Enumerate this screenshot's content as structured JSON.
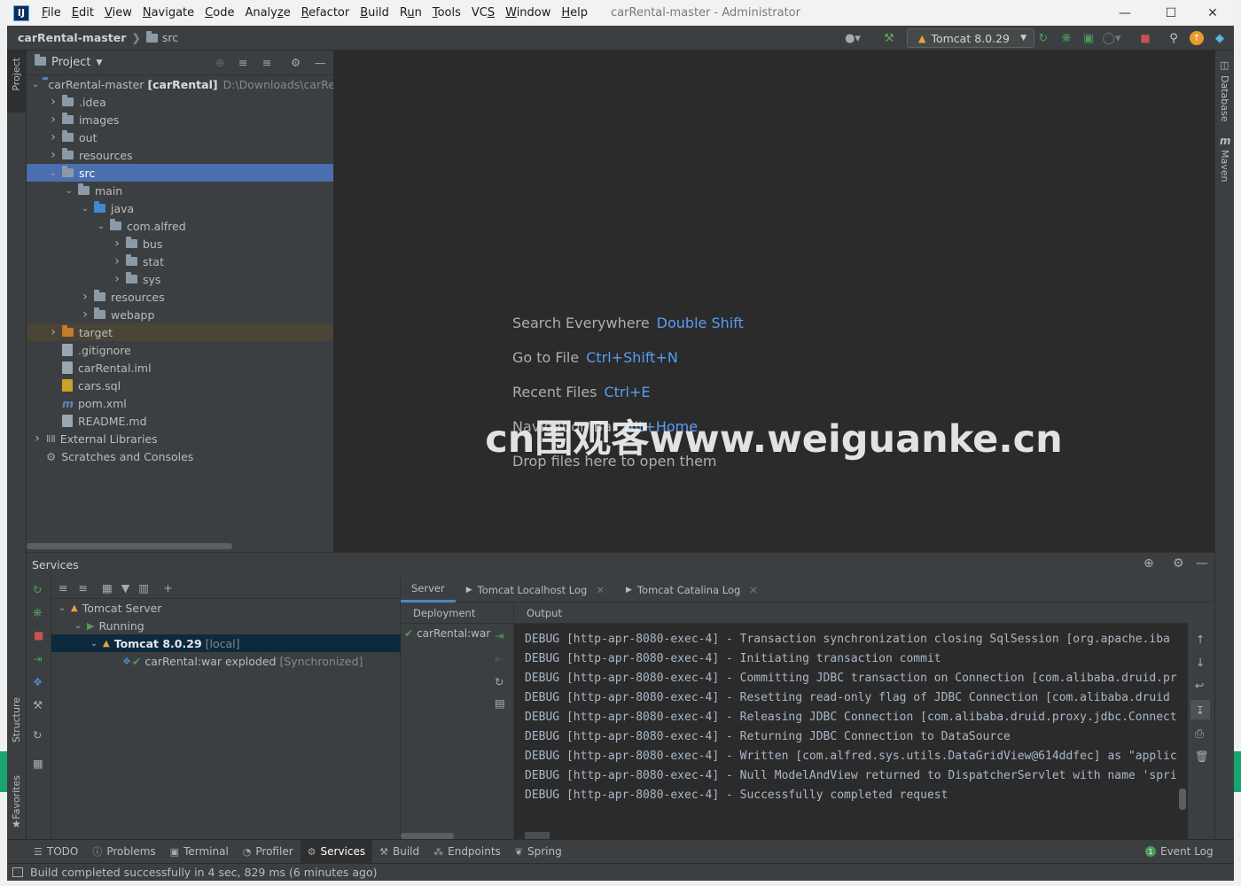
{
  "menubar": {
    "items": [
      {
        "pre": "",
        "u": "F",
        "post": "ile"
      },
      {
        "pre": "",
        "u": "E",
        "post": "dit"
      },
      {
        "pre": "",
        "u": "V",
        "post": "iew"
      },
      {
        "pre": "",
        "u": "N",
        "post": "avigate"
      },
      {
        "pre": "",
        "u": "C",
        "post": "ode"
      },
      {
        "pre": "Analy",
        "u": "z",
        "post": "e"
      },
      {
        "pre": "",
        "u": "R",
        "post": "efactor"
      },
      {
        "pre": "",
        "u": "B",
        "post": "uild"
      },
      {
        "pre": "R",
        "u": "u",
        "post": "n"
      },
      {
        "pre": "",
        "u": "T",
        "post": "ools"
      },
      {
        "pre": "VC",
        "u": "S",
        "post": ""
      },
      {
        "pre": "",
        "u": "W",
        "post": "indow"
      },
      {
        "pre": "",
        "u": "H",
        "post": "elp"
      }
    ],
    "window_title": "carRental-master - Administrator",
    "app_icon": "IJ"
  },
  "navbar": {
    "root": "carRental-master",
    "child": "src",
    "run_config": "Tomcat 8.0.29"
  },
  "side_tabs": {
    "project": "Project",
    "structure": "Structure",
    "favorites": "Favorites",
    "database": "Database",
    "maven": "Maven"
  },
  "project": {
    "title": "Project",
    "root_name": "carRental-master",
    "root_module": "[carRental]",
    "root_path": "D:\\Downloads\\carRen",
    "tree": [
      {
        "label": ".idea",
        "indent": 1
      },
      {
        "label": "images",
        "indent": 1
      },
      {
        "label": "out",
        "indent": 1
      },
      {
        "label": "resources",
        "indent": 1
      },
      {
        "label": "src",
        "indent": 1
      },
      {
        "label": "main",
        "indent": 2
      },
      {
        "label": "java",
        "indent": 3
      },
      {
        "label": "com.alfred",
        "indent": 4
      },
      {
        "label": "bus",
        "indent": 5
      },
      {
        "label": "stat",
        "indent": 5
      },
      {
        "label": "sys",
        "indent": 5
      },
      {
        "label": "resources",
        "indent": 3
      },
      {
        "label": "webapp",
        "indent": 3
      },
      {
        "label": "target",
        "indent": 1
      },
      {
        "label": ".gitignore",
        "indent": 1
      },
      {
        "label": "carRental.iml",
        "indent": 1
      },
      {
        "label": "cars.sql",
        "indent": 1
      },
      {
        "label": "pom.xml",
        "indent": 1
      },
      {
        "label": "README.md",
        "indent": 1
      },
      {
        "label": "External Libraries",
        "indent": 0
      },
      {
        "label": "Scratches and Consoles",
        "indent": 0
      }
    ]
  },
  "editor": {
    "hints": [
      {
        "text": "Search Everywhere",
        "key": "Double Shift"
      },
      {
        "text": "Go to File",
        "key": "Ctrl+Shift+N"
      },
      {
        "text": "Recent Files",
        "key": "Ctrl+E"
      },
      {
        "text": "Navigation Bar",
        "key": "Alt+Home"
      },
      {
        "text": "Drop files here to open them",
        "key": ""
      }
    ],
    "watermark": "cn围观客www.weiguanke.cn"
  },
  "services": {
    "title": "Services",
    "tree": {
      "server": "Tomcat Server",
      "status": "Running",
      "instance": "Tomcat 8.0.29",
      "instance_tag": "[local]",
      "artifact": "carRental:war exploded",
      "artifact_tag": "[Synchronized]"
    },
    "tabs": [
      "Server",
      "Tomcat Localhost Log",
      "Tomcat Catalina Log"
    ],
    "deployment_header": "Deployment",
    "deployment_item": "carRental:war",
    "output_header": "Output",
    "log": [
      "DEBUG [http-apr-8080-exec-4] - Transaction synchronization closing SqlSession [org.apache.iba",
      "DEBUG [http-apr-8080-exec-4] - Initiating transaction commit",
      "DEBUG [http-apr-8080-exec-4] - Committing JDBC transaction on Connection [com.alibaba.druid.pr",
      "DEBUG [http-apr-8080-exec-4] - Resetting read-only flag of JDBC Connection [com.alibaba.druid",
      "DEBUG [http-apr-8080-exec-4] - Releasing JDBC Connection [com.alibaba.druid.proxy.jdbc.Connect",
      "DEBUG [http-apr-8080-exec-4] - Returning JDBC Connection to DataSource",
      "DEBUG [http-apr-8080-exec-4] - Written [com.alfred.sys.utils.DataGridView@614ddfec] as \"applic",
      "DEBUG [http-apr-8080-exec-4] - Null ModelAndView returned to DispatcherServlet with name 'spri",
      "DEBUG [http-apr-8080-exec-4] - Successfully completed request"
    ]
  },
  "tool_tabs": [
    {
      "label": "TODO",
      "icon": "list-icon"
    },
    {
      "label": "Problems",
      "icon": "problems-icon"
    },
    {
      "label": "Terminal",
      "icon": "terminal-icon"
    },
    {
      "label": "Profiler",
      "icon": "profiler-icon"
    },
    {
      "label": "Services",
      "icon": "services-icon"
    },
    {
      "label": "Build",
      "icon": "hammer-icon"
    },
    {
      "label": "Endpoints",
      "icon": "endpoints-icon"
    },
    {
      "label": "Spring",
      "icon": "spring-icon"
    }
  ],
  "event_log": "Event Log",
  "status": "Build completed successfully in 4 sec, 829 ms (6 minutes ago)",
  "colors": {
    "selection": "#4b6eaf",
    "accent_link": "#589df6",
    "run_green": "#499c54",
    "stop_red": "#c75450"
  }
}
